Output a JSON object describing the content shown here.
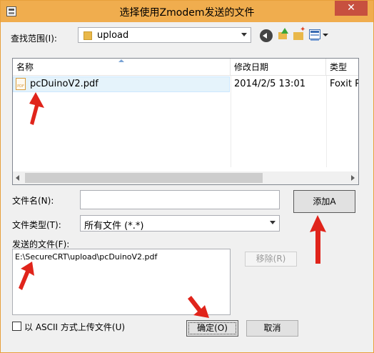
{
  "title": "选择使用Zmodem发送的文件",
  "close_label": "✕",
  "look_in": {
    "label": "查找范围(I):",
    "value": "upload"
  },
  "toolbar": {
    "icons": [
      "back-icon",
      "up-folder-icon",
      "new-folder-icon",
      "view-menu-icon"
    ]
  },
  "file_list": {
    "columns": [
      "名称",
      "修改日期",
      "类型"
    ],
    "rows": [
      {
        "name": "pcDuinoV2.pdf",
        "modified": "2014/2/5 13:01",
        "type": "Foxit Re"
      }
    ]
  },
  "filename": {
    "label": "文件名(N):",
    "value": ""
  },
  "filetype": {
    "label": "文件类型(T):",
    "value": "所有文件 (*.*)"
  },
  "add_button": "添加A",
  "send_files": {
    "label": "发送的文件(F):",
    "items": [
      "E:\\SecureCRT\\upload\\pcDuinoV2.pdf"
    ]
  },
  "remove_button": "移除(R)",
  "ascii_checkbox": {
    "label": "以 ASCII 方式上传文件(U)",
    "checked": false
  },
  "ok_button": "确定(O)",
  "cancel_button": "取消",
  "colors": {
    "titlebar": "#f0ad4e",
    "close": "#c7503f",
    "annotation_arrow": "#e0241b"
  }
}
